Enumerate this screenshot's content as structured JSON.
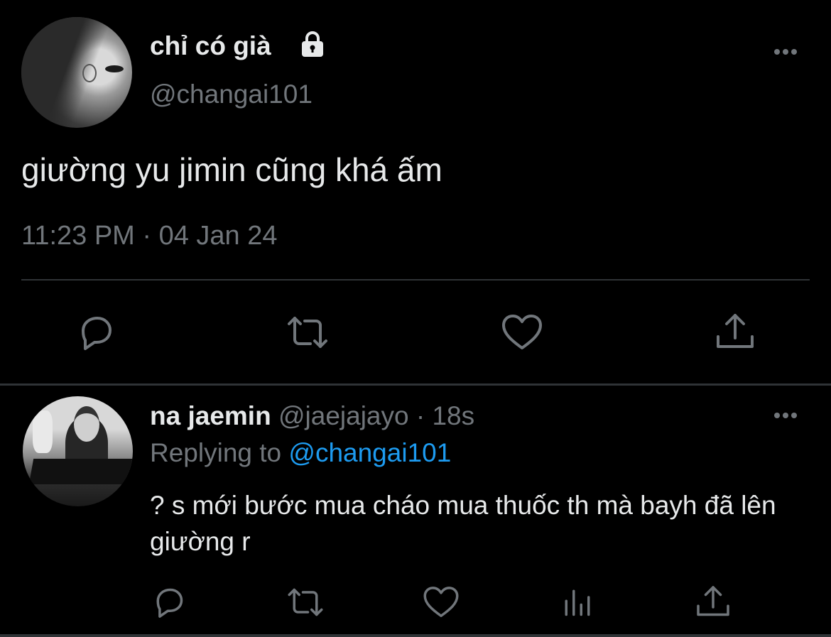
{
  "tweet": {
    "author_name": "chỉ có già",
    "author_handle": "@changai101",
    "text": "giường yu jimin cũng khá ấm",
    "timestamp": "11:23 PM · 04 Jan 24",
    "icons": [
      "lock-icon",
      "more-icon",
      "reply-icon",
      "retweet-icon",
      "like-icon",
      "share-icon"
    ]
  },
  "reply": {
    "author_name": "na jaemin",
    "author_handle": "@jaejajayo",
    "time_ago": "· 18s",
    "replying_label": "Replying to",
    "replying_to": "@changai101",
    "text": "? s mới bước mua cháo mua thuốc th mà bayh đã lên giường r",
    "icons": [
      "more-icon",
      "reply-icon",
      "retweet-icon",
      "like-icon",
      "analytics-icon",
      "share-icon"
    ]
  },
  "colors": {
    "background": "#000000",
    "primary_text": "#e7e9ea",
    "secondary_text": "#71767b",
    "link": "#1d9bf0",
    "divider": "#2f3336"
  }
}
